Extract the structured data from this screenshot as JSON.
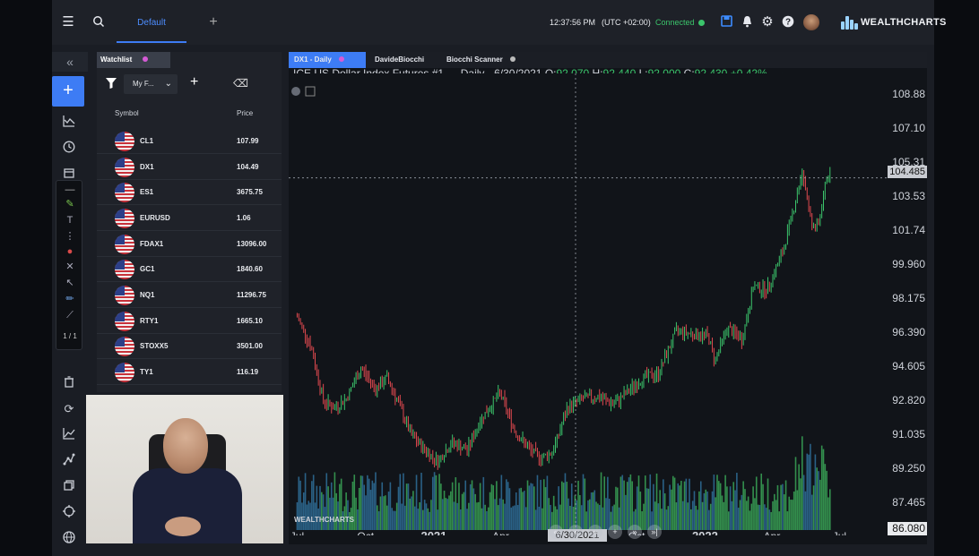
{
  "topbar": {
    "active_tab": "Default",
    "clock": "12:37:56 PM",
    "timezone": "(UTC +02:00)",
    "connection_status": "Connected",
    "brand": "WEALTHCHARTS",
    "icons": [
      "menu-icon",
      "search-icon",
      "plus-icon",
      "save-icon",
      "bell-icon",
      "gear-icon",
      "help-icon"
    ]
  },
  "sidebar": {
    "collapse_label": "«",
    "add_label": "+",
    "page_indicator": "1 / 1",
    "icons": [
      "line-chart-icon",
      "clock-icon",
      "calendar-icon",
      "trash-icon",
      "refresh-icon",
      "chart-icon",
      "nodes-icon",
      "copy-icon",
      "target-icon",
      "globe-icon"
    ]
  },
  "watchlist": {
    "tab_label": "Watchlist",
    "list_name": "My F...",
    "col_symbol": "Symbol",
    "col_price": "Price",
    "rows": [
      {
        "symbol": "CL1",
        "price": "107.99"
      },
      {
        "symbol": "DX1",
        "price": "104.49"
      },
      {
        "symbol": "ES1",
        "price": "3675.75"
      },
      {
        "symbol": "EURUSD",
        "price": "1.06"
      },
      {
        "symbol": "FDAX1",
        "price": "13096.00"
      },
      {
        "symbol": "GC1",
        "price": "1840.60"
      },
      {
        "symbol": "NQ1",
        "price": "11296.75"
      },
      {
        "symbol": "RTY1",
        "price": "1665.10"
      },
      {
        "symbol": "STOXX5",
        "price": "3501.00"
      },
      {
        "symbol": "TY1",
        "price": "116.19"
      }
    ]
  },
  "chart_tabs": [
    "DX1 - Daily",
    "DavideBiocchi",
    "Biocchi Scanner"
  ],
  "legend": {
    "symbol": "ICE US Dollar Index Futures #1",
    "meta": "- Daily - 6/30/2021",
    "o_label": "O:",
    "o": "92.070",
    "h_label": "H:",
    "h": "92.440",
    "l_label": "L:",
    "l": "92.000",
    "c_label": "C:",
    "c": "92.430",
    "change": "+0.42%"
  },
  "chart_overlay": {
    "current_price_tag": "104.485",
    "cursor_price_tag": "86.080",
    "cursor_date_tag": "6/30/2021",
    "brand": "WEALTHCHARTS",
    "nav_buttons": [
      "«",
      "‹",
      "‹‹",
      "+",
      "»",
      "»|"
    ]
  },
  "colors": {
    "accent": "#3d7cf5",
    "up": "#3bc46b",
    "down": "#e0494f",
    "background": "#111419"
  },
  "chart_data": {
    "type": "candlestick",
    "title": "ICE US Dollar Index Futures #1",
    "y_ticks": [
      "108.88",
      "107.10",
      "105.31",
      "103.53",
      "101.74",
      "99.960",
      "98.175",
      "96.390",
      "94.605",
      "92.820",
      "91.035",
      "89.250",
      "87.465"
    ],
    "x_ticks": [
      "Jul",
      "Oct",
      "2021",
      "Apr",
      "Jul",
      "Oct",
      "2022",
      "Apr",
      "Jul"
    ],
    "ylim": [
      86.0,
      109.5
    ],
    "grid": false,
    "series": [
      {
        "x": "2020-07-01",
        "close": 97.2
      },
      {
        "x": "2020-07-20",
        "close": 95.6
      },
      {
        "x": "2020-08-05",
        "close": 92.8
      },
      {
        "x": "2020-08-20",
        "close": 92.4
      },
      {
        "x": "2020-09-05",
        "close": 92.9
      },
      {
        "x": "2020-09-25",
        "close": 94.5
      },
      {
        "x": "2020-10-15",
        "close": 93.4
      },
      {
        "x": "2020-10-30",
        "close": 94.0
      },
      {
        "x": "2020-11-15",
        "close": 92.6
      },
      {
        "x": "2020-12-01",
        "close": 91.0
      },
      {
        "x": "2020-12-20",
        "close": 90.2
      },
      {
        "x": "2021-01-06",
        "close": 89.6
      },
      {
        "x": "2021-01-25",
        "close": 90.6
      },
      {
        "x": "2021-02-15",
        "close": 90.2
      },
      {
        "x": "2021-03-05",
        "close": 91.8
      },
      {
        "x": "2021-03-31",
        "close": 93.2
      },
      {
        "x": "2021-04-20",
        "close": 91.2
      },
      {
        "x": "2021-05-10",
        "close": 90.2
      },
      {
        "x": "2021-05-25",
        "close": 89.8
      },
      {
        "x": "2021-06-10",
        "close": 90.1
      },
      {
        "x": "2021-06-30",
        "close": 92.43
      },
      {
        "x": "2021-07-20",
        "close": 92.9
      },
      {
        "x": "2021-08-10",
        "close": 93.0
      },
      {
        "x": "2021-08-31",
        "close": 92.6
      },
      {
        "x": "2021-09-20",
        "close": 93.3
      },
      {
        "x": "2021-10-10",
        "close": 94.0
      },
      {
        "x": "2021-10-30",
        "close": 94.2
      },
      {
        "x": "2021-11-24",
        "close": 96.5
      },
      {
        "x": "2021-12-15",
        "close": 96.3
      },
      {
        "x": "2022-01-05",
        "close": 96.2
      },
      {
        "x": "2022-01-14",
        "close": 94.9
      },
      {
        "x": "2022-01-31",
        "close": 96.6
      },
      {
        "x": "2022-02-20",
        "close": 96.0
      },
      {
        "x": "2022-03-07",
        "close": 98.8
      },
      {
        "x": "2022-03-25",
        "close": 98.6
      },
      {
        "x": "2022-04-15",
        "close": 100.5
      },
      {
        "x": "2022-05-01",
        "close": 103.0
      },
      {
        "x": "2022-05-12",
        "close": 104.9
      },
      {
        "x": "2022-05-25",
        "close": 101.9
      },
      {
        "x": "2022-06-03",
        "close": 102.0
      },
      {
        "x": "2022-06-15",
        "close": 104.8
      },
      {
        "x": "2022-06-20",
        "close": 104.485
      }
    ]
  }
}
